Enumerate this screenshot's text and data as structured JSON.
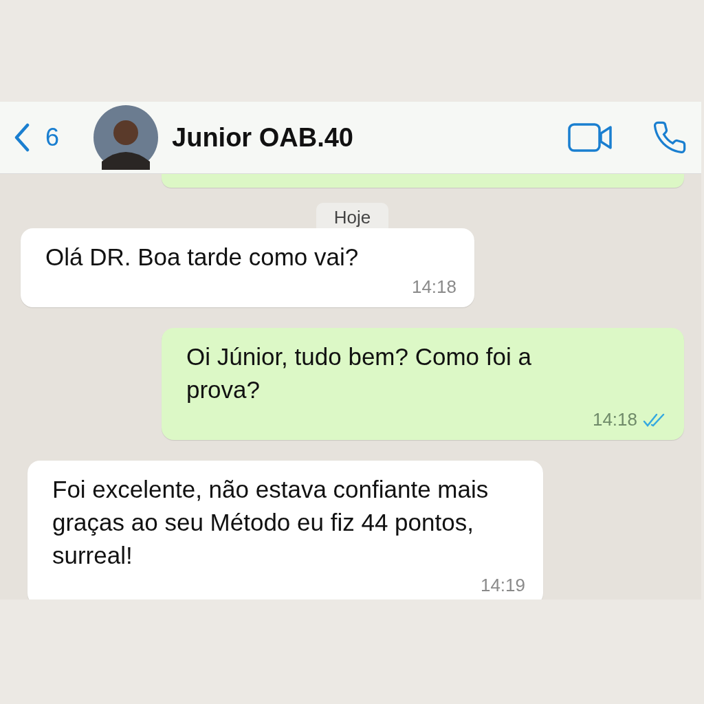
{
  "header": {
    "back_count": "6",
    "contact_name": "Junior OAB.40"
  },
  "date_chip": "Hoje",
  "messages": [
    {
      "kind": "incoming",
      "text": "Olá DR. Boa tarde como vai?",
      "time": "14:18"
    },
    {
      "kind": "outgoing",
      "text": "Oi Júnior, tudo bem? Como foi a prova?",
      "time": "14:18",
      "read": true
    },
    {
      "kind": "incoming",
      "text": "Foi excelente, não estava confiante mais graças ao seu Método eu fiz 44 pontos, surreal!",
      "time": "14:19"
    }
  ]
}
